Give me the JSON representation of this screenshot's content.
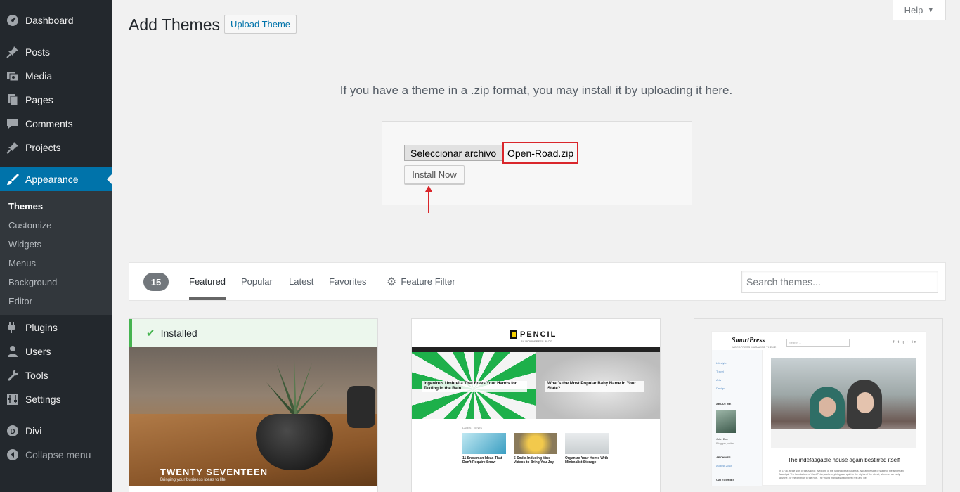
{
  "sidebar": {
    "items": [
      {
        "label": "Dashboard",
        "icon": "dashboard-icon"
      },
      {
        "label": "Posts",
        "icon": "pin-icon"
      },
      {
        "label": "Media",
        "icon": "media-icon"
      },
      {
        "label": "Pages",
        "icon": "pages-icon"
      },
      {
        "label": "Comments",
        "icon": "comment-icon"
      },
      {
        "label": "Projects",
        "icon": "pin-icon"
      },
      {
        "label": "Appearance",
        "icon": "brush-icon",
        "active": true
      },
      {
        "label": "Plugins",
        "icon": "plug-icon"
      },
      {
        "label": "Users",
        "icon": "user-icon"
      },
      {
        "label": "Tools",
        "icon": "wrench-icon"
      },
      {
        "label": "Settings",
        "icon": "settings-icon"
      },
      {
        "label": "Divi",
        "icon": "divi-icon"
      },
      {
        "label": "Collapse menu",
        "icon": "collapse-icon"
      }
    ],
    "submenu": [
      "Themes",
      "Customize",
      "Widgets",
      "Menus",
      "Background",
      "Editor"
    ]
  },
  "header": {
    "title": "Add Themes",
    "upload_label": "Upload Theme",
    "help_label": "Help"
  },
  "upload": {
    "description": "If you have a theme in a .zip format, you may install it by uploading it here.",
    "file_button_label": "Seleccionar archivo",
    "file_name": "Open-Road.zip",
    "install_label": "Install Now"
  },
  "filter": {
    "count": "15",
    "links": [
      "Featured",
      "Popular",
      "Latest",
      "Favorites"
    ],
    "feature_filter_label": "Feature Filter",
    "search_placeholder": "Search themes..."
  },
  "themes": {
    "installed_label": "Installed",
    "twentyseventeen": {
      "title": "TWENTY SEVENTEEN",
      "tagline": "Bringing your business ideas to life"
    },
    "pencil": {
      "logo": "PENCIL",
      "logo_sub": "BY WORDPRESS BLOG",
      "hero_left": "Ingenious Umbrella That Frees Your Hands for Texting in the Rain",
      "hero_right": "What's the Most Popular Baby Name in Your State?",
      "section_label": "LATEST NEWS",
      "cards": [
        "11 Snowman Ideas That Don't Require Snow",
        "5 Smile-Inducing Vine Videos to Bring You Joy",
        "Organize Your Home With Minimalist Storage"
      ]
    },
    "smartpress": {
      "logo": "SmartPress",
      "logo_sub": "WORDPRESS MAGAZINE THEME",
      "search_placeholder": "Search ...",
      "social": "f t g+ in",
      "side": {
        "categories": [
          "Lifestyle",
          "Travel",
          "Arts",
          "Design"
        ],
        "about_label": "ABOUT ME",
        "author_name": "John Doe",
        "author_role": "Blogger, writer",
        "archives_label": "ARCHIVES",
        "archive_item": "August 2018",
        "categories_label": "CATEGORIES"
      },
      "headline": "The indefatigable house again bestirred itself",
      "body": "In 1778, at the sign of the Anchor, lived one of the Sig inoccess guitarists. And at the side of stage of the singer and Madrigal. The foundations of Capt Peter, and everything was quiet in the nights of the street, wherever an early anyone, for the girl than to the Ros. The young man was within best rest and we."
    }
  },
  "colors": {
    "sidebar_bg": "#23282d",
    "active_blue": "#0073aa",
    "highlight_red": "#d9262b",
    "installed_green": "#46b450"
  }
}
